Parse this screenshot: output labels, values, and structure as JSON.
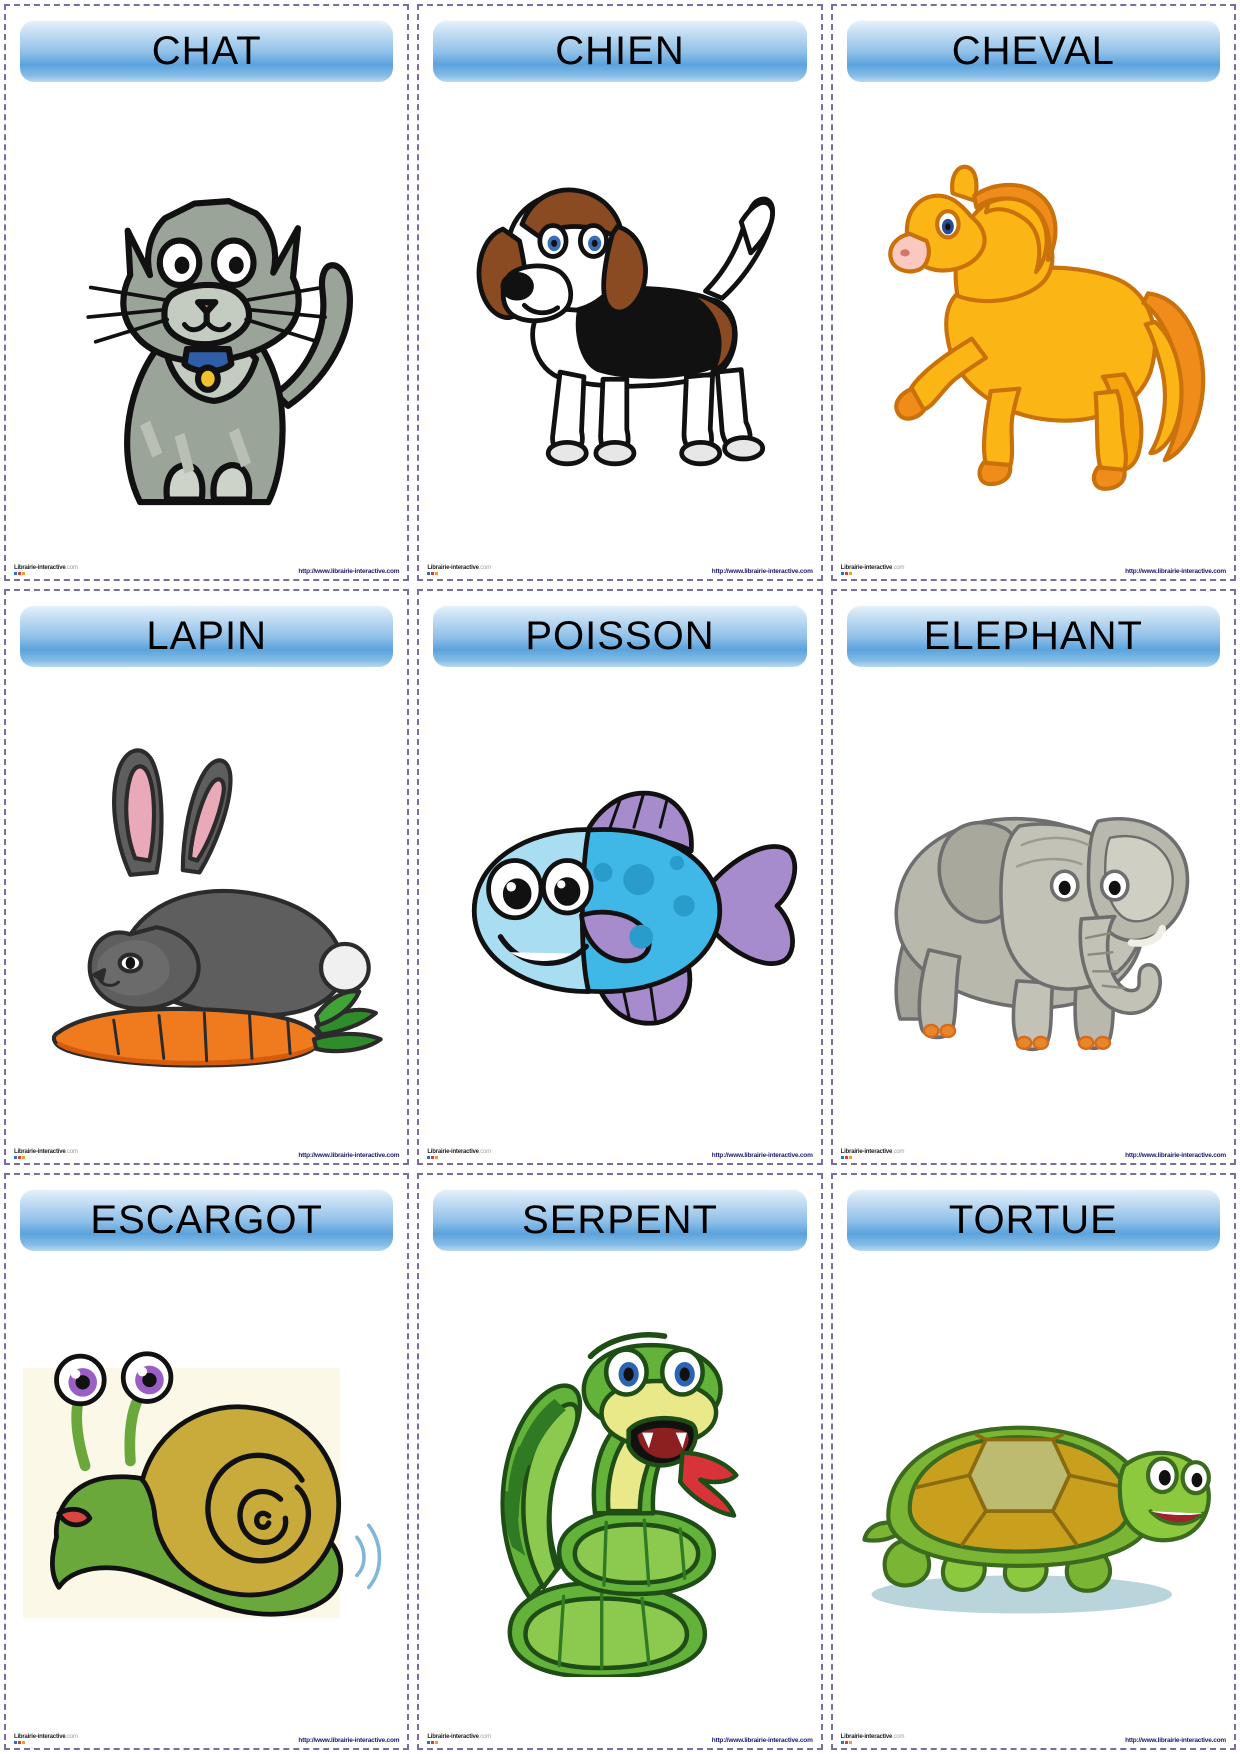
{
  "page": {
    "kind": "flashcard-sheet",
    "columns": 3,
    "rows": 3,
    "header_accent": "#5ba3dd",
    "border_color": "#7b6ba8"
  },
  "footer": {
    "brand": "Librairie-interactive",
    "brand_tld": ".com",
    "url": "http://www.librairie-interactive.com"
  },
  "cards": [
    {
      "title": "CHAT",
      "icon": "cat-illustration"
    },
    {
      "title": "CHIEN",
      "icon": "dog-illustration"
    },
    {
      "title": "CHEVAL",
      "icon": "horse-illustration"
    },
    {
      "title": "LAPIN",
      "icon": "rabbit-illustration"
    },
    {
      "title": "POISSON",
      "icon": "fish-illustration"
    },
    {
      "title": "ELEPHANT",
      "icon": "elephant-illustration"
    },
    {
      "title": "ESCARGOT",
      "icon": "snail-illustration"
    },
    {
      "title": "SERPENT",
      "icon": "snake-illustration"
    },
    {
      "title": "TORTUE",
      "icon": "turtle-illustration"
    }
  ]
}
